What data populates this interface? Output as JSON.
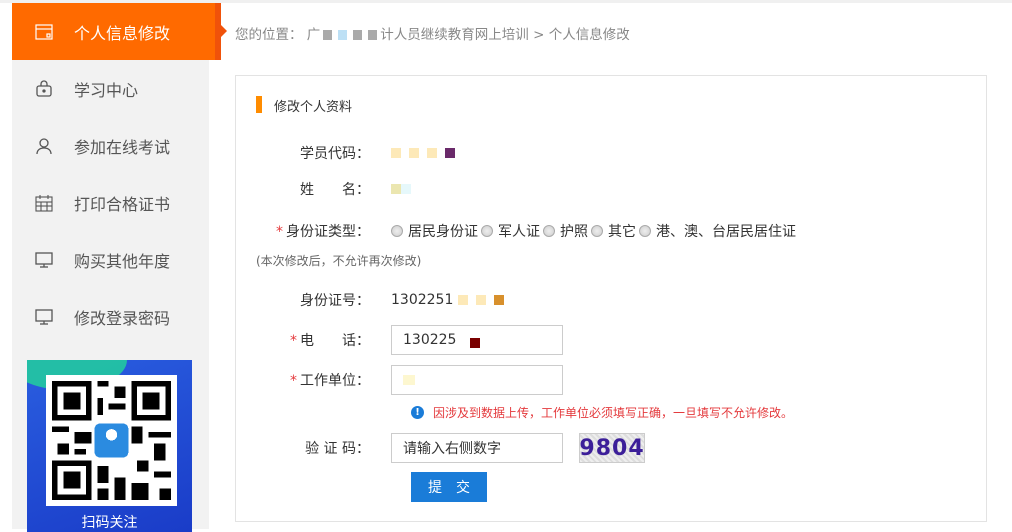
{
  "sidebar": {
    "items": [
      {
        "label": "个人信息修改",
        "icon": "calendar-icon",
        "active": true
      },
      {
        "label": "学习中心",
        "icon": "lock-bag-icon"
      },
      {
        "label": "参加在线考试",
        "icon": "user-icon"
      },
      {
        "label": "打印合格证书",
        "icon": "calendar-grid-icon"
      },
      {
        "label": "购买其他年度",
        "icon": "monitor-icon"
      },
      {
        "label": "修改登录密码",
        "icon": "monitor-icon"
      }
    ],
    "qr_caption": "扫码关注"
  },
  "breadcrumb": {
    "prefix": "您的位置：",
    "site_start": "广",
    "site_end": "计人员继续教育网上培训",
    "sep": ">",
    "current": "个人信息修改"
  },
  "form": {
    "section_title": "修改个人资料",
    "student_code_label": "学员代码：",
    "name_label": "姓　　名：",
    "id_type_label": "身份证类型：",
    "id_type_options": [
      "居民身份证",
      "军人证",
      "护照",
      "其它",
      "港、澳、台居民居住证"
    ],
    "note": "(本次修改后，不允许再次修改)",
    "id_number_label": "身份证号：",
    "id_number_value": "1302251",
    "phone_label": "电　　话：",
    "phone_value": "130225",
    "work_label": "工作单位：",
    "warning": "因涉及到数据上传，工作单位必须填写正确，一旦填写不允许修改。",
    "captcha_label": "验 证 码：",
    "captcha_placeholder": "请输入右侧数字",
    "captcha_image_text": "9804",
    "submit_label": "提交",
    "required_mark": "*",
    "warn_icon": "!"
  },
  "colors": {
    "accent": "#ff6a00",
    "primary": "#1a7cd8",
    "error": "#e4393c"
  }
}
